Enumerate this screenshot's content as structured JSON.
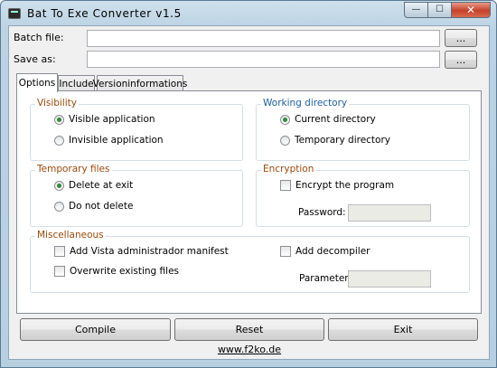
{
  "window": {
    "title": "Bat To Exe Converter v1.5",
    "controls": {
      "minimize": "—",
      "maximize": "☐",
      "close": "✕"
    }
  },
  "fields": {
    "batch_file": {
      "label": "Batch file:",
      "value": "",
      "browse": "..."
    },
    "save_as": {
      "label": "Save as:",
      "value": "",
      "browse": "..."
    }
  },
  "tabs": [
    "Options",
    "Include",
    "Versioninformations"
  ],
  "visibility": {
    "title": "Visibility",
    "visible": "Visible application",
    "invisible": "Invisible application",
    "selected": "visible"
  },
  "working_directory": {
    "title": "Working directory",
    "current": "Current directory",
    "temporary": "Temporary directory",
    "selected": "current"
  },
  "temporary_files": {
    "title": "Temporary files",
    "delete": "Delete at exit",
    "keep": "Do not delete",
    "selected": "delete"
  },
  "encryption": {
    "title": "Encryption",
    "encrypt": "Encrypt the program",
    "encrypt_checked": false,
    "password_label": "Password:",
    "password_value": ""
  },
  "miscellaneous": {
    "title": "Miscellaneous",
    "vista_manifest": "Add Vista administrador manifest",
    "overwrite": "Overwrite existing files",
    "decompiler": "Add decompiler",
    "parameter_label": "Parameter:",
    "parameter_value": ""
  },
  "buttons": {
    "compile": "Compile",
    "reset": "Reset",
    "exit": "Exit"
  },
  "footer": {
    "link": "www.f2ko.de"
  }
}
